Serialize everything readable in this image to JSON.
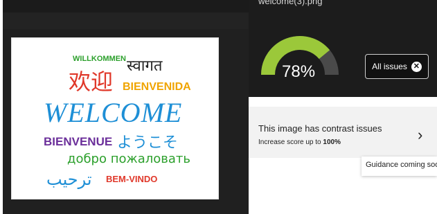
{
  "file": {
    "name": "welcome(3).png"
  },
  "preview": {
    "words": {
      "willkommen": "WILLKOMMEN",
      "hindi": "स्वागत",
      "chinese": "欢迎",
      "bienvenida": "BIENVENIDA",
      "welcome": "WELCOME",
      "bienvenue": "BIENVENUE",
      "japanese": "ようこそ",
      "russian": "добро пожаловать",
      "arabic": "ترحيب",
      "bemvindo": "BEM-VINDO"
    },
    "colors": {
      "green": "#2ca02c",
      "red": "#e0382a",
      "orange": "#f0a400",
      "blue": "#1e8fd6",
      "purple": "#6b2f9a"
    }
  },
  "score": {
    "value": 0.78,
    "label": "78%",
    "gauge_color": "#9bc83a",
    "track_color": "#4a4a4a"
  },
  "toolbar": {
    "all_issues_label": "All issues",
    "close_icon": "close-icon"
  },
  "issue": {
    "title": "This image has contrast issues",
    "subtitle_prefix": "Increase score up to",
    "subtitle_value": "100%",
    "chevron_icon": "chevron-right-icon"
  },
  "tooltip": {
    "text": "Guidance coming soon"
  }
}
